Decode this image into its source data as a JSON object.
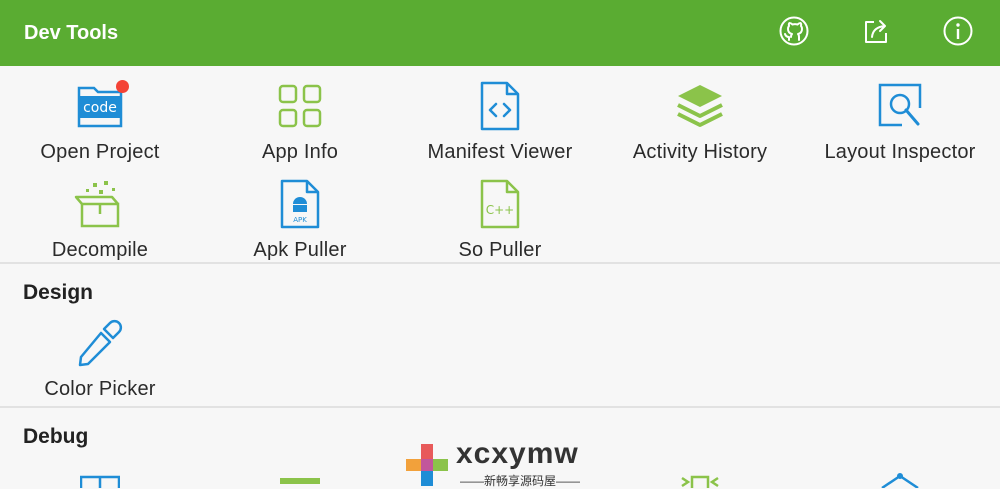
{
  "app": {
    "title": "Dev Tools",
    "accent": "#5aac32",
    "actions": [
      {
        "name": "github-icon"
      },
      {
        "name": "share-icon"
      },
      {
        "name": "info-icon"
      }
    ]
  },
  "tools": [
    {
      "label": "Open Project",
      "icon": "code-folder-icon"
    },
    {
      "label": "App Info",
      "icon": "grid-apps-icon"
    },
    {
      "label": "Manifest Viewer",
      "icon": "code-file-icon"
    },
    {
      "label": "Activity History",
      "icon": "layers-icon"
    },
    {
      "label": "Layout Inspector",
      "icon": "inspect-magnifier-icon"
    },
    {
      "label": "Decompile",
      "icon": "open-box-icon"
    },
    {
      "label": "Apk Puller",
      "icon": "apk-file-icon"
    },
    {
      "label": "So Puller",
      "icon": "cpp-file-icon"
    }
  ],
  "badges": {
    "open_project_icon_text": "code",
    "apk_text": "APK",
    "cpp_text": "C++"
  },
  "design": {
    "title": "Design",
    "items": [
      {
        "label": "Color Picker",
        "icon": "eyedropper-icon"
      }
    ]
  },
  "debug": {
    "title": "Debug"
  },
  "watermark": {
    "text": "xcxymw",
    "sub": "——新畅享源码屋——"
  }
}
